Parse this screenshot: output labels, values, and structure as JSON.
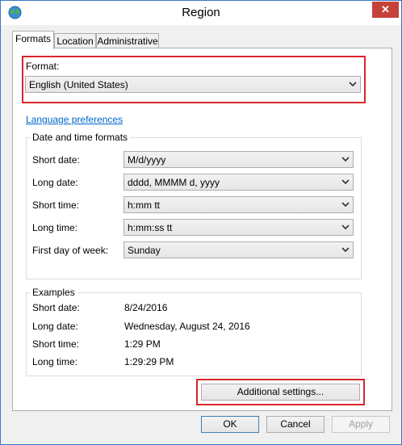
{
  "window": {
    "title": "Region",
    "close_glyph": "✕"
  },
  "tabs": [
    {
      "label": "Formats",
      "active": true
    },
    {
      "label": "Location",
      "active": false
    },
    {
      "label": "Administrative",
      "active": false
    }
  ],
  "format": {
    "label": "Format:",
    "value": "English (United States)"
  },
  "language_link": "Language preferences",
  "datetime": {
    "title": "Date and time formats",
    "rows": [
      {
        "label": "Short date:",
        "value": "M/d/yyyy"
      },
      {
        "label": "Long date:",
        "value": "dddd, MMMM d, yyyy"
      },
      {
        "label": "Short time:",
        "value": "h:mm tt"
      },
      {
        "label": "Long time:",
        "value": "h:mm:ss tt"
      },
      {
        "label": "First day of week:",
        "value": "Sunday"
      }
    ]
  },
  "examples": {
    "title": "Examples",
    "rows": [
      {
        "label": "Short date:",
        "value": "8/24/2016"
      },
      {
        "label": "Long date:",
        "value": "Wednesday, August 24, 2016"
      },
      {
        "label": "Short time:",
        "value": "1:29 PM"
      },
      {
        "label": "Long time:",
        "value": "1:29:29 PM"
      }
    ]
  },
  "additional_settings": "Additional settings...",
  "footer": {
    "ok": "OK",
    "cancel": "Cancel",
    "apply": "Apply"
  },
  "colors": {
    "highlight": "#d9262c",
    "close": "#c7413b",
    "link": "#0066cc"
  },
  "icons": {
    "app": "globe-icon",
    "dropdown": "chevron-down-icon"
  }
}
